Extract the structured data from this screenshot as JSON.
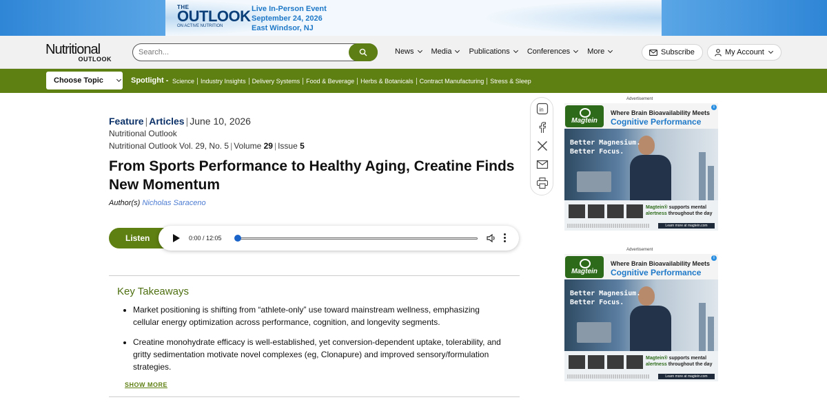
{
  "banner": {
    "the": "THE",
    "outlook": "OUTLOOK",
    "sub": "ON ACTIVE NUTRITION",
    "event_line1": "Live In-Person Event",
    "event_line2": "September 24, 2026",
    "event_line3": "East Windsor, NJ"
  },
  "header": {
    "logo_main": "Nutritional",
    "logo_sub": "OUTLOOK",
    "search_placeholder": "Search...",
    "nav": [
      "News",
      "Media",
      "Publications",
      "Conferences",
      "More"
    ],
    "subscribe": "Subscribe",
    "account": "My Account"
  },
  "topicbar": {
    "choose_topic": "Choose Topic",
    "spotlight_label": "Spotlight -",
    "links": [
      "Science",
      "Industry Insights",
      "Delivery Systems",
      "Food & Beverage",
      "Herbs & Botanicals",
      "Contract Manufacturing",
      "Stress & Sleep"
    ]
  },
  "article": {
    "type": "Feature",
    "category": "Articles",
    "date": "June 10, 2026",
    "publication": "Nutritional Outlook",
    "issue_prefix": "Nutritional Outlook Vol. 29, No. 5",
    "volume_label": "Volume",
    "volume": "29",
    "issue_label": "Issue",
    "issue": "5",
    "title": "From Sports Performance to Healthy Aging, Creatine Finds New Momentum",
    "author_label": "Author(s)",
    "author": "Nicholas Saraceno"
  },
  "player": {
    "listen": "Listen",
    "time": "0:00 / 12:05",
    "progress": 0
  },
  "takeaways": {
    "title": "Key Takeaways",
    "items": [
      "Market positioning is shifting from “athlete-only” use toward mainstream wellness, emphasizing cellular energy optimization across performance, cognition, and longevity segments.",
      "Creatine monohydrate efficacy is well-established, yet conversion-dependent uptake, tolerability, and gritty sedimentation motivate novel complexes (eg, Clonapure) and improved sensory/formulation strategies."
    ],
    "show_more": "SHOW MORE"
  },
  "share_icons": [
    "linkedin-icon",
    "facebook-icon",
    "x-icon",
    "email-icon",
    "print-icon"
  ],
  "ads": [
    {
      "label": "Advertisement",
      "brand": "Magtein",
      "headline1": "Where Brain Bioavailability Meets",
      "headline2": "Cognitive Performance",
      "slogan1": "Better Magnesium.",
      "slogan2": "Better Focus.",
      "support_brand": "Magtein®",
      "support_text1": "supports mental",
      "support_text2": "alertness",
      "support_text3": "throughout the day",
      "learn_more": "Learn more at magtein.com"
    },
    {
      "label": "Advertisement",
      "brand": "Magtein",
      "headline1": "Where Brain Bioavailability Meets",
      "headline2": "Cognitive Performance",
      "slogan1": "Better Magnesium.",
      "slogan2": "Better Focus.",
      "support_brand": "Magtein®",
      "support_text1": "supports mental",
      "support_text2": "alertness",
      "support_text3": "throughout the day",
      "learn_more": "Learn more at magtein.com"
    }
  ],
  "colors": {
    "brand_green": "#5e7f12",
    "navy": "#0b3168",
    "link_blue": "#4b7bd1"
  }
}
